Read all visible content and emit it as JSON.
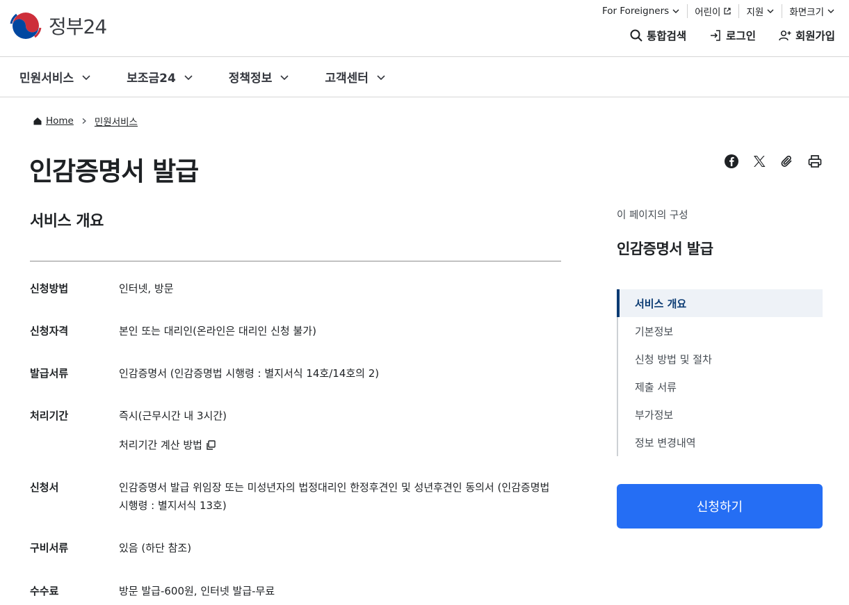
{
  "header": {
    "logo_text": "정부24",
    "util_nav": [
      {
        "label": "For Foreigners",
        "icon": "chevron-down-icon"
      },
      {
        "label": "어린이",
        "icon": "external-link-icon"
      },
      {
        "label": "지원",
        "icon": "chevron-down-icon"
      },
      {
        "label": "화면크기",
        "icon": "chevron-down-icon"
      }
    ],
    "search_label": "통합검색",
    "login_label": "로그인",
    "signup_label": "회원가입"
  },
  "gnb": {
    "items": [
      "민원서비스",
      "보조금24",
      "정책정보",
      "고객센터"
    ]
  },
  "breadcrumb": {
    "home": "Home",
    "current": "민원서비스"
  },
  "page": {
    "title": "인감증명서 발급"
  },
  "overview": {
    "title": "서비스 개요",
    "rows": [
      {
        "label": "신청방법",
        "value": "인터넷, 방문"
      },
      {
        "label": "신청자격",
        "value": "본인 또는 대리인(온라인은 대리인 신청 불가)"
      },
      {
        "label": "발급서류",
        "value": "인감증명서 (인감증명법 시행령 : 별지서식 14호/14호의 2)"
      },
      {
        "label": "처리기간",
        "value": "즉시(근무시간 내 3시간)",
        "sub_link": "처리기간 계산 방법"
      },
      {
        "label": "신청서",
        "value": "인감증명서 발급 위임장 또는 미성년자의 법정대리인 한정후견인 및 성년후견인 동의서 (인감증명법 시행령 : 별지서식 13호)"
      },
      {
        "label": "구비서류",
        "value": "있음 (하단 참조)"
      },
      {
        "label": "수수료",
        "value": "방문 발급-600원, 인터넷 발급-무료"
      }
    ]
  },
  "sidebar": {
    "caption": "이 페이지의 구성",
    "title": "인감증명서 발급",
    "toc": [
      "서비스 개요",
      "기본정보",
      "신청 방법 및 절차",
      "제출 서류",
      "부가정보",
      "정보 변경내역"
    ],
    "apply_label": "신청하기"
  }
}
